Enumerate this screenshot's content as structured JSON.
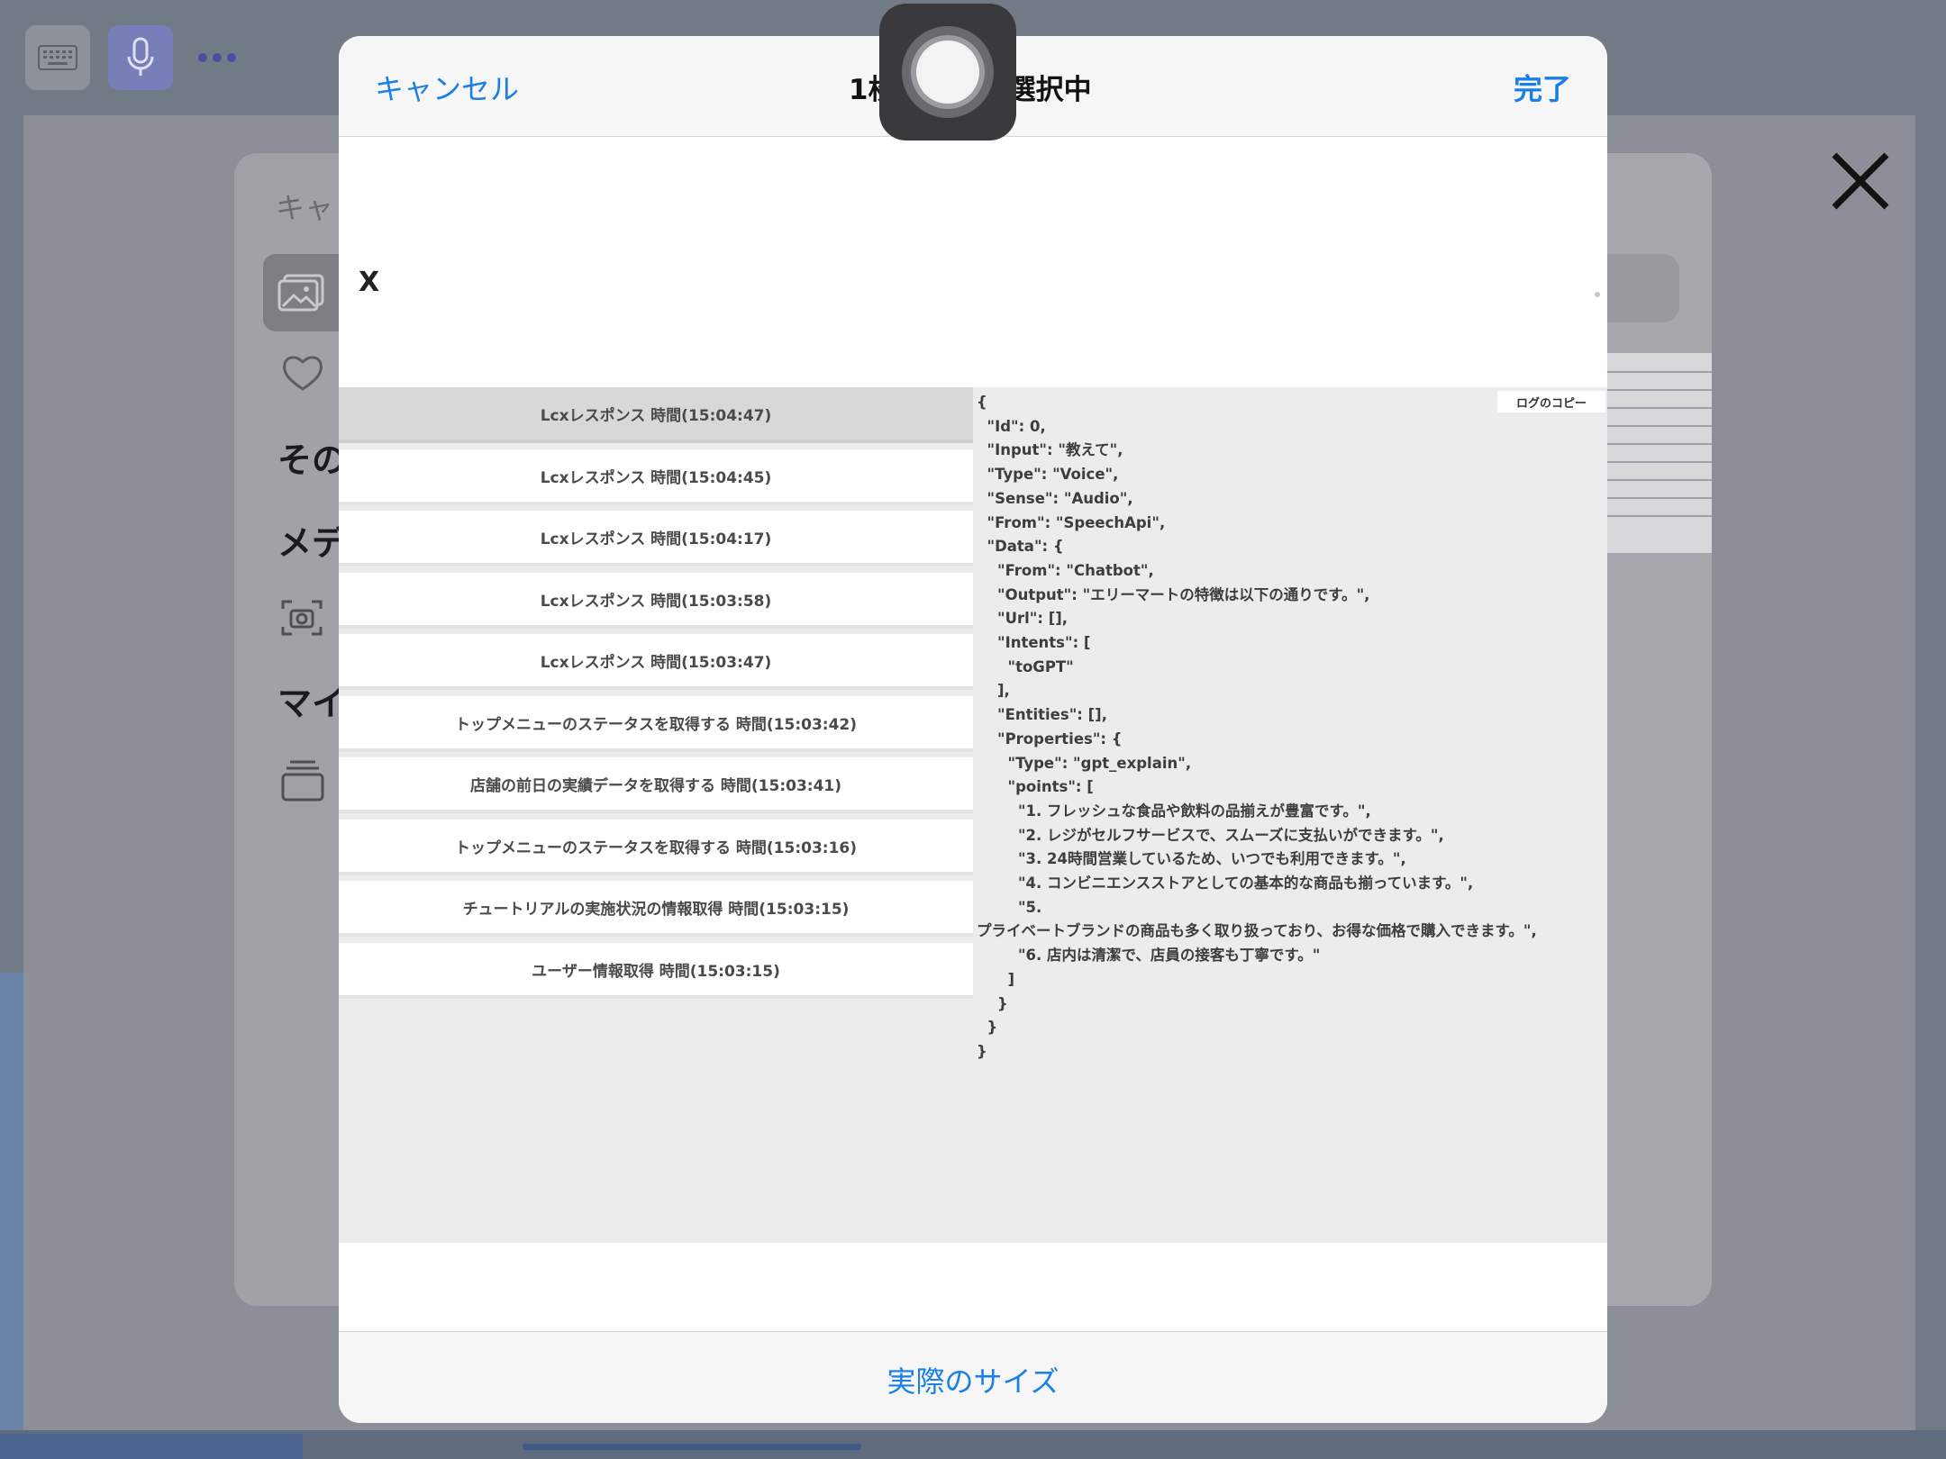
{
  "background": {
    "sheet_cancel": "キャ",
    "side_labels": [
      "その",
      "メデ",
      "マイ"
    ]
  },
  "modal": {
    "header": {
      "cancel": "キャンセル",
      "title": "1枚の写真を選択中",
      "done": "完了"
    },
    "footer": {
      "actual_size": "実際のサイズ"
    },
    "preview": {
      "close_label": "X",
      "copy_log": "ログのコピー",
      "log_items": [
        "Lcxレスポンス 時間(15:04:47)",
        "Lcxレスポンス 時間(15:04:45)",
        "Lcxレスポンス 時間(15:04:17)",
        "Lcxレスポンス 時間(15:03:58)",
        "Lcxレスポンス 時間(15:03:47)",
        "トップメニューのステータスを取得する 時間(15:03:42)",
        "店舗の前日の実績データを取得する 時間(15:03:41)",
        "トップメニューのステータスを取得する 時間(15:03:16)",
        "チュートリアルの実施状況の情報取得 時間(15:03:15)",
        "ユーザー情報取得 時間(15:03:15)"
      ],
      "json_lines": [
        "{",
        "  \"Id\": 0,",
        "  \"Input\": \"教えて\",",
        "  \"Type\": \"Voice\",",
        "  \"Sense\": \"Audio\",",
        "  \"From\": \"SpeechApi\",",
        "  \"Data\": {",
        "    \"From\": \"Chatbot\",",
        "    \"Output\": \"エリーマートの特徴は以下の通りです。\",",
        "    \"Url\": [],",
        "    \"Intents\": [",
        "      \"toGPT\"",
        "    ],",
        "    \"Entities\": [],",
        "    \"Properties\": {",
        "      \"Type\": \"gpt_explain\",",
        "      \"points\": [",
        "        \"1. フレッシュな食品や飲料の品揃えが豊富です。\",",
        "        \"2. レジがセルフサービスで、スムーズに支払いができます。\",",
        "        \"3. 24時間営業しているため、いつでも利用できます。\",",
        "        \"4. コンビニエンスストアとしての基本的な商品も揃っています。\",",
        "        \"5.",
        "プライベートブランドの商品も多く取り扱っており、お得な価格で購入できます。\",",
        "        \"6. 店内は清潔で、店員の接客も丁寧です。\"",
        "      ]",
        "    }",
        "  }",
        "}"
      ]
    }
  }
}
